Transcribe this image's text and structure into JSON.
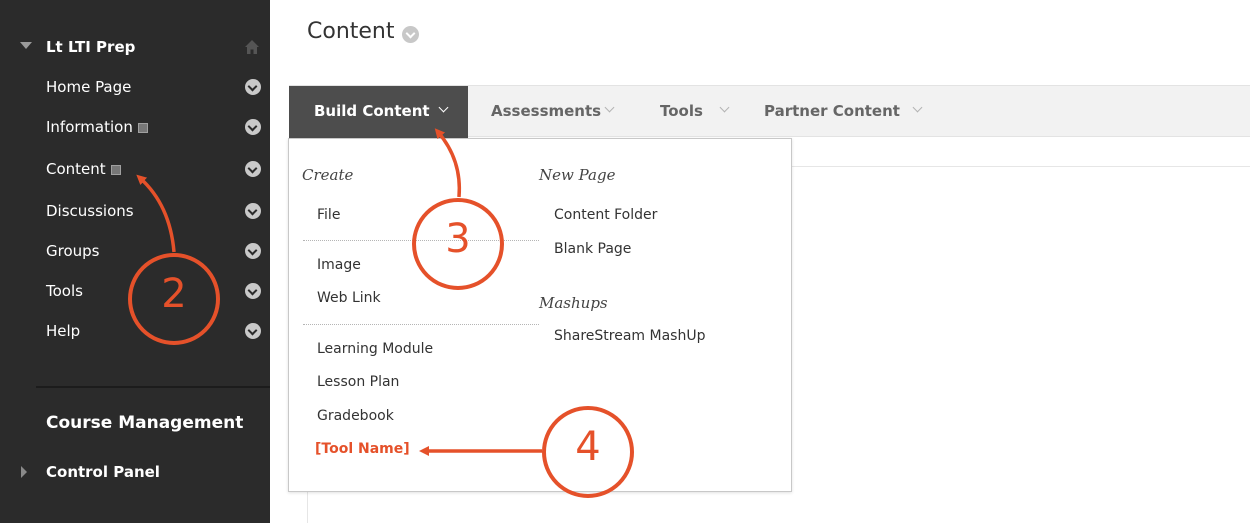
{
  "sidebar": {
    "course_title": "Lt LTI Prep",
    "items": [
      {
        "label": "Home Page"
      },
      {
        "label": "Information"
      },
      {
        "label": "Content"
      },
      {
        "label": "Discussions"
      },
      {
        "label": "Groups"
      },
      {
        "label": "Tools"
      },
      {
        "label": "Help"
      }
    ],
    "course_management": "Course Management",
    "control_panel": "Control Panel"
  },
  "main": {
    "page_title": "Content",
    "toolbar": {
      "buttons": [
        {
          "label": "Build Content"
        },
        {
          "label": "Assessments"
        },
        {
          "label": "Tools"
        },
        {
          "label": "Partner Content"
        }
      ]
    }
  },
  "dropdown": {
    "create_heading": "Create",
    "create_items": [
      "File",
      "Image",
      "Web Link",
      "Learning Module",
      "Lesson Plan",
      "Gradebook",
      "[Tool Name]"
    ],
    "new_page_heading": "New Page",
    "new_page_items": [
      "Content Folder",
      "Blank Page"
    ],
    "mashups_heading": "Mashups",
    "mashups_items": [
      "ShareStream MashUp"
    ]
  },
  "annotations": {
    "steps": [
      "2",
      "3",
      "4"
    ],
    "color": "#e5512a"
  },
  "colors": {
    "sidebar_bg": "#2b2b2b",
    "toolbar_active": "#4d4d4d",
    "accent": "#e5512a"
  }
}
